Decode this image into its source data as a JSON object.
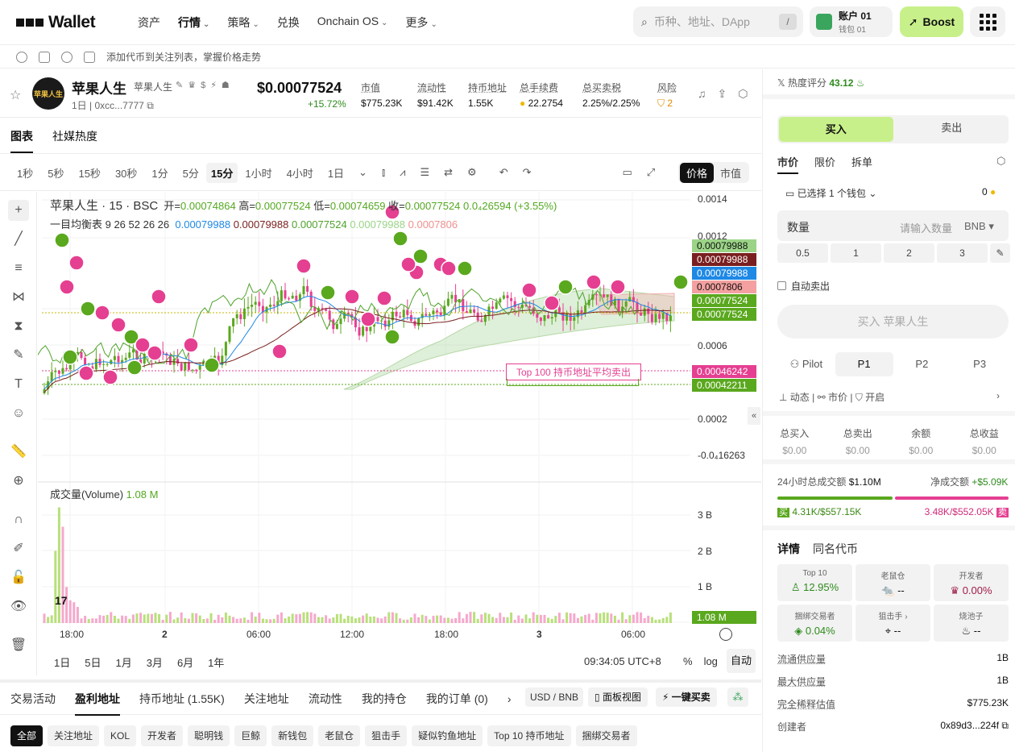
{
  "nav": {
    "brand": "Wallet",
    "items": [
      "资产",
      "行情",
      "策略",
      "兑换",
      "Onchain OS",
      "更多"
    ],
    "search_placeholder": "币种、地址、DApp",
    "search_shortcut": "/",
    "account_name": "账户 01",
    "account_sub": "钱包 01",
    "boost_label": "Boost"
  },
  "watchbar": {
    "hint": "添加代币到关注列表，掌握价格走势"
  },
  "token": {
    "name": "苹果人生",
    "symbol": "苹果人生",
    "avatar_text": "苹果人生",
    "age": "1日",
    "address": "0xcc...7777",
    "price": "$0.00077524",
    "change": "+15.72%",
    "stats": [
      {
        "key": "市值",
        "value": "$775.23K"
      },
      {
        "key": "流动性",
        "value": "$91.42K"
      },
      {
        "key": "持币地址",
        "value": "1.55K"
      },
      {
        "key": "总手续费",
        "value": "22.2754"
      },
      {
        "key": "总买卖税",
        "value": "2.25%/2.25%"
      },
      {
        "key": "风险",
        "value": "2"
      }
    ]
  },
  "chart_tabs": [
    "图表",
    "社媒热度"
  ],
  "timeframes": [
    "1秒",
    "5秒",
    "15秒",
    "30秒",
    "1分",
    "5分",
    "15分",
    "1小时",
    "4小时",
    "1日"
  ],
  "active_timeframe": "15分",
  "price_toggle": [
    "价格",
    "市值"
  ],
  "legend": {
    "title": "苹果人生 · 15 · BSC",
    "open_label": "开=",
    "open": "0.00074864",
    "high_label": "高=",
    "high": "0.00077524",
    "low_label": "低=",
    "low": "0.00074659",
    "close_label": "收=",
    "close": "0.00077524",
    "delta": "0.0₄26594 (+3.55%)",
    "ichimoku_label": "一目均衡表 9 26 52 26 26",
    "ichimoku_values": [
      "0.00079988",
      "0.00079988",
      "0.00077524",
      "0.00079988",
      "0.0007806"
    ],
    "volume_label": "成交量(Volume)",
    "volume_value": "1.08 M",
    "avg_sell_label": "Top 100 持币地址平均卖出"
  },
  "chart_data": {
    "type": "candlestick",
    "price_axis": [
      "0.0014",
      "0.0012",
      "0.0006",
      "0.0002",
      "-0.0₄16263"
    ],
    "price_tags": [
      {
        "value": "0.00079988",
        "color": "#9bd487"
      },
      {
        "value": "0.00079988",
        "color": "#7a1f1f"
      },
      {
        "value": "0.00079988",
        "color": "#1e88e5"
      },
      {
        "value": "0.0007806",
        "color": "#f4a0a0"
      },
      {
        "value": "0.00077524",
        "color": "#5aa81e"
      },
      {
        "value": "0.00077524",
        "color": "#5aa81e"
      },
      {
        "value": "0.00046242",
        "color": "#e53f91"
      },
      {
        "value": "0.00042211",
        "color": "#5aa81e"
      }
    ],
    "volume_axis": [
      "3 B",
      "2 B",
      "1 B"
    ],
    "volume_tag": "1.08 M",
    "time_axis": [
      "18:00",
      "2",
      "06:00",
      "12:00",
      "18:00",
      "3",
      "06:00"
    ],
    "up_color": "#5aa81e",
    "down_color": "#e53f91"
  },
  "ranges": [
    "1日",
    "5日",
    "1月",
    "3月",
    "6月",
    "1年"
  ],
  "clock": "09:34:05 UTC+8",
  "scale_opts": [
    "%",
    "log",
    "自动"
  ],
  "bottom_tabs": [
    "交易活动",
    "盈利地址",
    "持币地址 (1.55K)",
    "关注地址",
    "流动性",
    "我的持仓",
    "我的订单 (0)"
  ],
  "currency_toggle": "USD / BNB",
  "panel_view": "面板视图",
  "one_click": "一键买卖",
  "filters": [
    "全部",
    "关注地址",
    "KOL",
    "开发者",
    "聪明钱",
    "巨鲸",
    "新钱包",
    "老鼠仓",
    "狙击手",
    "疑似钓鱼地址",
    "Top 10 持币地址",
    "捆绑交易者"
  ],
  "right": {
    "heat_label": "热度评分",
    "heat_value": "43.12",
    "buy": "买入",
    "sell": "卖出",
    "order_types": [
      "市价",
      "限价",
      "拆单"
    ],
    "wallet_selected": "已选择 1 个钱包",
    "wallet_balance": "0",
    "qty_label": "数量",
    "qty_placeholder": "请输入数量",
    "qty_unit": "BNB",
    "presets": [
      "0.5",
      "1",
      "2",
      "3"
    ],
    "auto_sell": "自动卖出",
    "buy_button": "买入 苹果人生",
    "pilot": [
      "Pilot",
      "P1",
      "P2",
      "P3"
    ],
    "pilot_opts": [
      "动态",
      "市价",
      "开启"
    ],
    "totals": [
      {
        "k": "总买入",
        "v": "$0.00"
      },
      {
        "k": "总卖出",
        "v": "$0.00"
      },
      {
        "k": "余额",
        "v": "$0.00"
      },
      {
        "k": "总收益",
        "v": "$0.00"
      }
    ],
    "vol24_label": "24小时总成交额",
    "vol24_value": "$1.10M",
    "net_label": "净成交额",
    "net_value": "+$5.09K",
    "buy_count": "4.31K/$557.15K",
    "sell_count": "3.48K/$552.05K",
    "buy_tag": "买",
    "sell_tag": "卖",
    "detail_tabs": [
      "详情",
      "同名代币"
    ],
    "cards": [
      {
        "t": "Top 10",
        "v": "12.95%"
      },
      {
        "t": "老鼠仓",
        "v": "--"
      },
      {
        "t": "开发者",
        "v": "0.00%"
      },
      {
        "t": "捆绑交易者",
        "v": "0.04%"
      },
      {
        "t": "狙击手",
        "v": "--"
      },
      {
        "t": "烧池子",
        "v": "--"
      }
    ],
    "supply": [
      {
        "k": "流通供应量",
        "v": "1B"
      },
      {
        "k": "最大供应量",
        "v": "1B"
      },
      {
        "k": "完全稀释估值",
        "v": "$775.23K"
      },
      {
        "k": "创建者",
        "v": "0x89d3...224f"
      }
    ]
  }
}
